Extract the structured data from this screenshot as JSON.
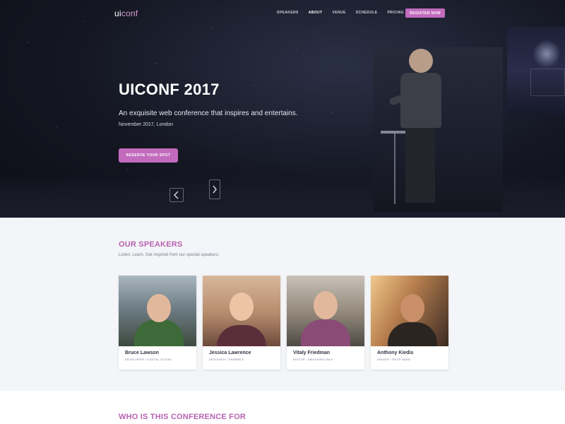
{
  "header": {
    "logo": {
      "part1": "ui",
      "part2": "conf"
    },
    "nav": [
      {
        "label": "SPEAKERS",
        "active": false
      },
      {
        "label": "ABOUT",
        "active": true
      },
      {
        "label": "VENUE",
        "active": false
      },
      {
        "label": "SCHEDULE",
        "active": false
      },
      {
        "label": "PRICING",
        "active": false
      }
    ],
    "cta": "REGISTER NOW"
  },
  "hero": {
    "title": "UICONF 2017",
    "subtitle": "An exquisite web conference that inspires and entertains.",
    "date": "November 2017, London",
    "cta": "RESERVE YOUR SPOT"
  },
  "speakers": {
    "title": "OUR SPEAKERS",
    "subtitle": "Listen. Learn. Get inspired from our special speakers.",
    "items": [
      {
        "name": "Bruce Lawson",
        "role": "DEVELOPER / DIGITAL OCEAN"
      },
      {
        "name": "Jessica Lawrence",
        "role": "DESIGNER / DRIBBBLE"
      },
      {
        "name": "Vitaly Friedman",
        "role": "EDITOR / SMASHING MAG"
      },
      {
        "name": "Anthony Kiedis",
        "role": "SINGER / RHCP BAND"
      }
    ]
  },
  "who": {
    "title": "WHO IS THIS CONFERENCE FOR"
  },
  "colors": {
    "accent": "#c26bbd",
    "heading": "#b763b0",
    "hero_bg": "#141722",
    "section_bg": "#f4f5f8"
  },
  "icons": [
    "chevron-left-icon",
    "chevron-right-icon"
  ]
}
